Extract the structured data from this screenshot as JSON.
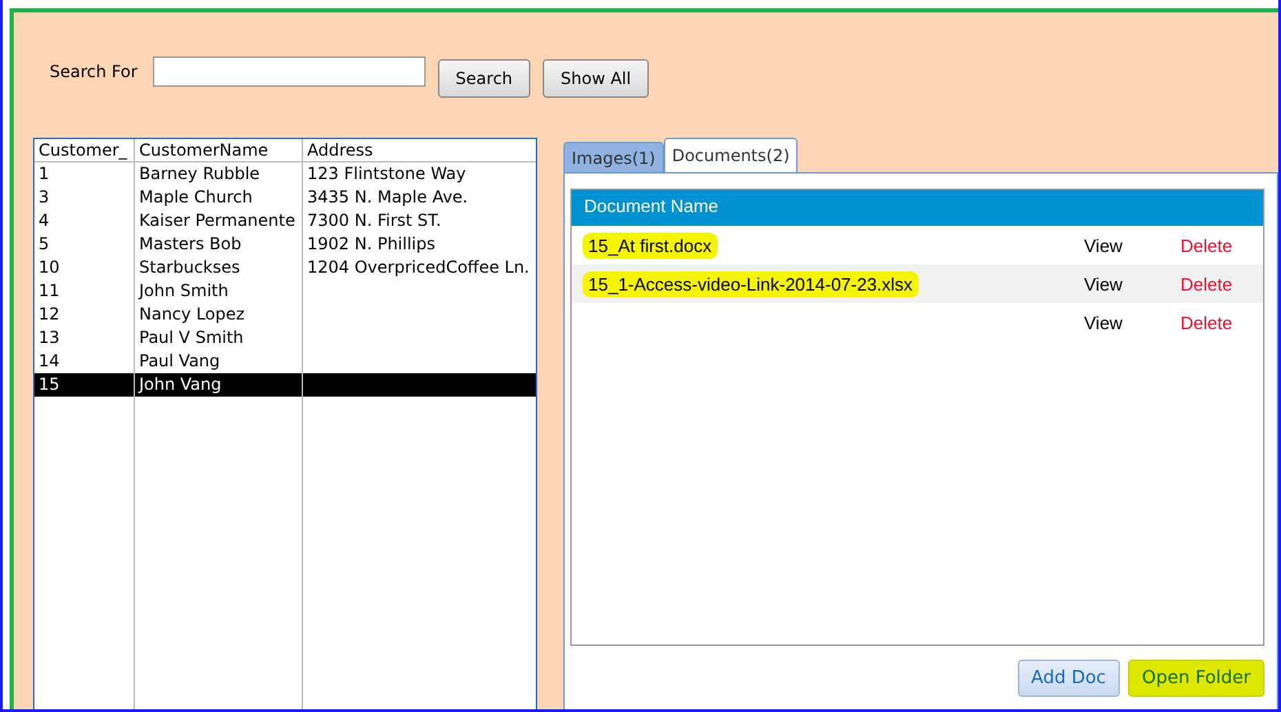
{
  "search": {
    "label": "Search For",
    "button": "Search",
    "show_all": "Show All"
  },
  "customers": {
    "columns": [
      "Customer_",
      "CustomerName",
      "Address"
    ],
    "rows": [
      {
        "cells": [
          "1",
          "Barney Rubble",
          "123 Flintstone Way"
        ],
        "selected": false
      },
      {
        "cells": [
          "3",
          "Maple Church",
          "3435 N. Maple Ave."
        ],
        "selected": false
      },
      {
        "cells": [
          "4",
          "Kaiser Permanente",
          "7300 N. First ST."
        ],
        "selected": false
      },
      {
        "cells": [
          "5",
          "Masters Bob",
          "1902 N. Phillips"
        ],
        "selected": false
      },
      {
        "cells": [
          "10",
          "Starbuckses",
          "1204 OverpricedCoffee Ln."
        ],
        "selected": false
      },
      {
        "cells": [
          "11",
          "John Smith",
          ""
        ],
        "selected": false
      },
      {
        "cells": [
          "12",
          "Nancy Lopez",
          ""
        ],
        "selected": false
      },
      {
        "cells": [
          "13",
          "Paul V Smith",
          ""
        ],
        "selected": false
      },
      {
        "cells": [
          "14",
          "Paul Vang",
          ""
        ],
        "selected": false
      },
      {
        "cells": [
          "15",
          "John Vang",
          ""
        ],
        "selected": true
      }
    ]
  },
  "tabs": [
    {
      "label": "Images(1)",
      "selected": false
    },
    {
      "label": "Documents(2)",
      "selected": true
    }
  ],
  "documents": {
    "column": "Document Name",
    "rows": [
      {
        "name": "15_At first.docx",
        "highlighted": true,
        "view": "View",
        "delete": "Delete"
      },
      {
        "name": "15_1-Access-video-Link-2014-07-23.xlsx",
        "highlighted": true,
        "view": "View",
        "delete": "Delete"
      },
      {
        "view": "View",
        "delete": "Delete"
      }
    ]
  },
  "buttons": [
    {
      "label": "Add Doc",
      "highlighted": false
    },
    {
      "label": "Open Folder",
      "highlighted": true
    }
  ]
}
